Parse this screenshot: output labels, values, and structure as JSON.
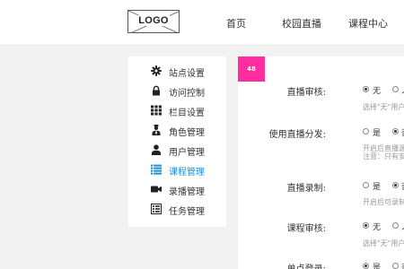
{
  "header": {
    "logo_text": "LOGO",
    "nav": [
      "首页",
      "校园直播",
      "课程中心"
    ]
  },
  "sidebar": {
    "items": [
      {
        "label": "站点设置",
        "icon": "gear-icon"
      },
      {
        "label": "访问控制",
        "icon": "lock-icon"
      },
      {
        "label": "栏目设置",
        "icon": "grid-icon"
      },
      {
        "label": "角色管理",
        "icon": "user-role-icon"
      },
      {
        "label": "用户管理",
        "icon": "user-icon"
      },
      {
        "label": "课程管理",
        "icon": "list-icon",
        "active": true
      },
      {
        "label": "录播管理",
        "icon": "video-camera-icon"
      },
      {
        "label": "任务管理",
        "icon": "tasks-icon"
      }
    ]
  },
  "main": {
    "badge": "48",
    "settings": [
      {
        "label": "直播审核:",
        "opt1": "无",
        "opt2": "人",
        "hint": "选择\"无\"用户"
      },
      {
        "label": "使用直播分发:",
        "opt1": "是",
        "opt2": "否",
        "hint": "开启后直播源",
        "hint2": "注意：只有安"
      },
      {
        "label": "直播录制:",
        "opt1": "是",
        "opt2": "否",
        "hint": "开启后可录制"
      },
      {
        "label": "课程审核:",
        "opt1": "无",
        "opt2": "人",
        "hint": "选择\"无\"用户"
      },
      {
        "label": "单点登录:",
        "opt1": "是",
        "opt2": "否"
      }
    ]
  },
  "colors": {
    "accent": "#1a8fd8",
    "badge": "#ff2d9f"
  }
}
